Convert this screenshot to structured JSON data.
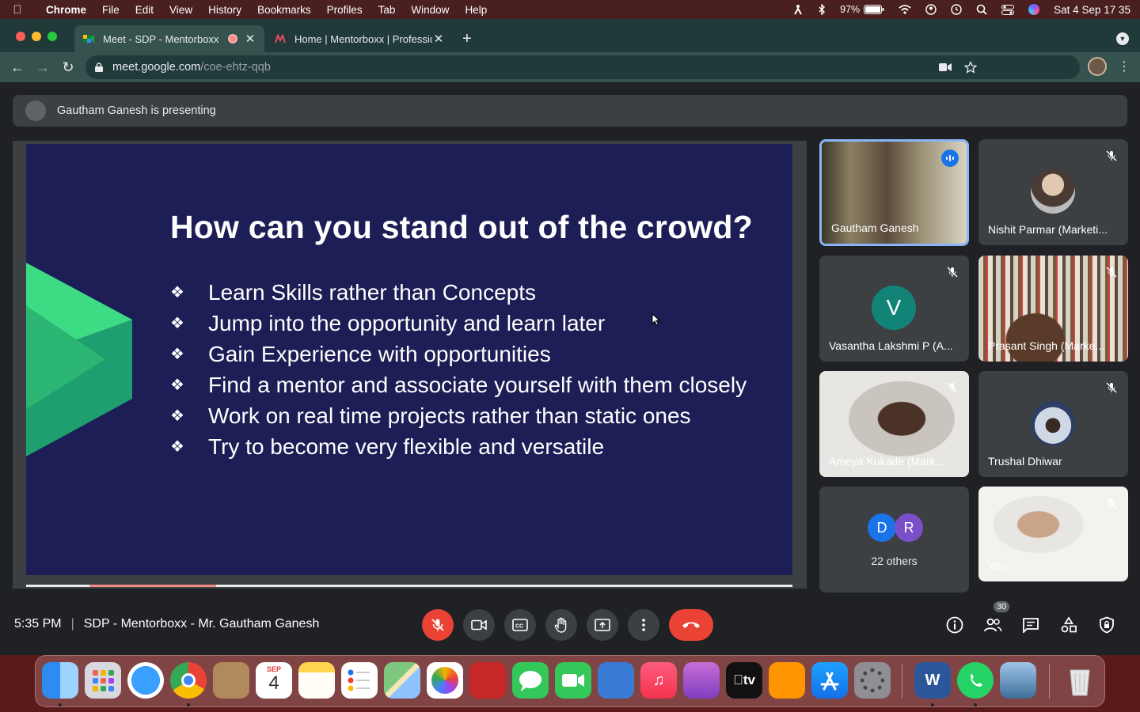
{
  "menubar": {
    "app": "Chrome",
    "items": [
      "File",
      "Edit",
      "View",
      "History",
      "Bookmarks",
      "Profiles",
      "Tab",
      "Window",
      "Help"
    ],
    "battery": "97%",
    "datetime": "Sat 4 Sep  17 35"
  },
  "tabs": [
    {
      "title": "Meet - SDP - Mentorboxx"
    },
    {
      "title": "Home | Mentorboxx | Professio"
    }
  ],
  "omnibox": {
    "host": "meet.google.com",
    "path": "/coe-ehtz-qqb"
  },
  "meet": {
    "presenting_text": "Gautham Ganesh is presenting",
    "slide": {
      "title": "How can you stand out of the crowd?",
      "bullets": [
        "Learn Skills rather than Concepts",
        "Jump into the opportunity and learn later",
        "Gain Experience with opportunities",
        "Find a mentor and associate yourself with them closely",
        "Work on real time projects rather than static ones",
        "Try to become very flexible and versatile"
      ]
    },
    "participants": [
      {
        "name": "Gautham Ganesh"
      },
      {
        "name": "Nishit Parmar (Marketi..."
      },
      {
        "name": "Vasantha Lakshmi P (A...",
        "initial": "V"
      },
      {
        "name": "Prasant Singh (Marke..."
      },
      {
        "name": "Ameya Kukade (Mark..."
      },
      {
        "name": "Trushal Dhiwar"
      },
      {
        "name": "22 others",
        "initials": [
          "D",
          "R"
        ]
      },
      {
        "name": "You"
      }
    ],
    "time": "5:35 PM",
    "meeting_title": "SDP - Mentorboxx - Mr. Gautham Ganesh",
    "people_count": "30"
  },
  "dock": {
    "calendar_month": "SEP",
    "calendar_day": "4",
    "tv_label": "tv"
  }
}
